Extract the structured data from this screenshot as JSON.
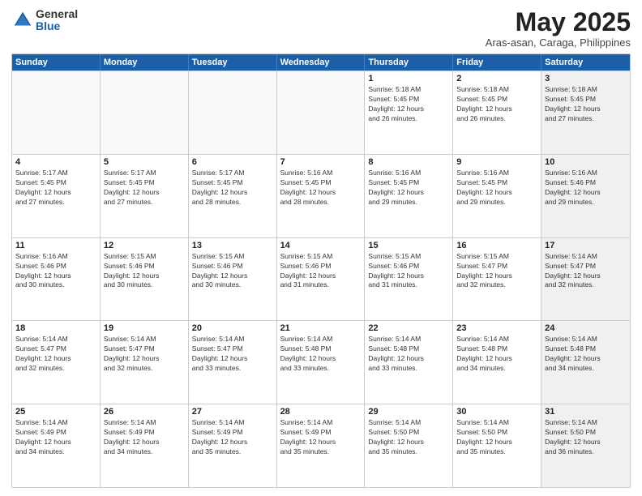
{
  "header": {
    "logo_general": "General",
    "logo_blue": "Blue",
    "month_year": "May 2025",
    "location": "Aras-asan, Caraga, Philippines"
  },
  "days_of_week": [
    "Sunday",
    "Monday",
    "Tuesday",
    "Wednesday",
    "Thursday",
    "Friday",
    "Saturday"
  ],
  "weeks": [
    [
      {
        "day": "",
        "empty": true
      },
      {
        "day": "",
        "empty": true
      },
      {
        "day": "",
        "empty": true
      },
      {
        "day": "",
        "empty": true
      },
      {
        "day": "1",
        "lines": [
          "Sunrise: 5:18 AM",
          "Sunset: 5:45 PM",
          "Daylight: 12 hours",
          "and 26 minutes."
        ]
      },
      {
        "day": "2",
        "lines": [
          "Sunrise: 5:18 AM",
          "Sunset: 5:45 PM",
          "Daylight: 12 hours",
          "and 26 minutes."
        ]
      },
      {
        "day": "3",
        "shaded": true,
        "lines": [
          "Sunrise: 5:18 AM",
          "Sunset: 5:45 PM",
          "Daylight: 12 hours",
          "and 27 minutes."
        ]
      }
    ],
    [
      {
        "day": "4",
        "lines": [
          "Sunrise: 5:17 AM",
          "Sunset: 5:45 PM",
          "Daylight: 12 hours",
          "and 27 minutes."
        ]
      },
      {
        "day": "5",
        "lines": [
          "Sunrise: 5:17 AM",
          "Sunset: 5:45 PM",
          "Daylight: 12 hours",
          "and 27 minutes."
        ]
      },
      {
        "day": "6",
        "lines": [
          "Sunrise: 5:17 AM",
          "Sunset: 5:45 PM",
          "Daylight: 12 hours",
          "and 28 minutes."
        ]
      },
      {
        "day": "7",
        "lines": [
          "Sunrise: 5:16 AM",
          "Sunset: 5:45 PM",
          "Daylight: 12 hours",
          "and 28 minutes."
        ]
      },
      {
        "day": "8",
        "lines": [
          "Sunrise: 5:16 AM",
          "Sunset: 5:45 PM",
          "Daylight: 12 hours",
          "and 29 minutes."
        ]
      },
      {
        "day": "9",
        "lines": [
          "Sunrise: 5:16 AM",
          "Sunset: 5:45 PM",
          "Daylight: 12 hours",
          "and 29 minutes."
        ]
      },
      {
        "day": "10",
        "shaded": true,
        "lines": [
          "Sunrise: 5:16 AM",
          "Sunset: 5:46 PM",
          "Daylight: 12 hours",
          "and 29 minutes."
        ]
      }
    ],
    [
      {
        "day": "11",
        "lines": [
          "Sunrise: 5:16 AM",
          "Sunset: 5:46 PM",
          "Daylight: 12 hours",
          "and 30 minutes."
        ]
      },
      {
        "day": "12",
        "lines": [
          "Sunrise: 5:15 AM",
          "Sunset: 5:46 PM",
          "Daylight: 12 hours",
          "and 30 minutes."
        ]
      },
      {
        "day": "13",
        "lines": [
          "Sunrise: 5:15 AM",
          "Sunset: 5:46 PM",
          "Daylight: 12 hours",
          "and 30 minutes."
        ]
      },
      {
        "day": "14",
        "lines": [
          "Sunrise: 5:15 AM",
          "Sunset: 5:46 PM",
          "Daylight: 12 hours",
          "and 31 minutes."
        ]
      },
      {
        "day": "15",
        "lines": [
          "Sunrise: 5:15 AM",
          "Sunset: 5:46 PM",
          "Daylight: 12 hours",
          "and 31 minutes."
        ]
      },
      {
        "day": "16",
        "lines": [
          "Sunrise: 5:15 AM",
          "Sunset: 5:47 PM",
          "Daylight: 12 hours",
          "and 32 minutes."
        ]
      },
      {
        "day": "17",
        "shaded": true,
        "lines": [
          "Sunrise: 5:14 AM",
          "Sunset: 5:47 PM",
          "Daylight: 12 hours",
          "and 32 minutes."
        ]
      }
    ],
    [
      {
        "day": "18",
        "lines": [
          "Sunrise: 5:14 AM",
          "Sunset: 5:47 PM",
          "Daylight: 12 hours",
          "and 32 minutes."
        ]
      },
      {
        "day": "19",
        "lines": [
          "Sunrise: 5:14 AM",
          "Sunset: 5:47 PM",
          "Daylight: 12 hours",
          "and 32 minutes."
        ]
      },
      {
        "day": "20",
        "lines": [
          "Sunrise: 5:14 AM",
          "Sunset: 5:47 PM",
          "Daylight: 12 hours",
          "and 33 minutes."
        ]
      },
      {
        "day": "21",
        "lines": [
          "Sunrise: 5:14 AM",
          "Sunset: 5:48 PM",
          "Daylight: 12 hours",
          "and 33 minutes."
        ]
      },
      {
        "day": "22",
        "lines": [
          "Sunrise: 5:14 AM",
          "Sunset: 5:48 PM",
          "Daylight: 12 hours",
          "and 33 minutes."
        ]
      },
      {
        "day": "23",
        "lines": [
          "Sunrise: 5:14 AM",
          "Sunset: 5:48 PM",
          "Daylight: 12 hours",
          "and 34 minutes."
        ]
      },
      {
        "day": "24",
        "shaded": true,
        "lines": [
          "Sunrise: 5:14 AM",
          "Sunset: 5:48 PM",
          "Daylight: 12 hours",
          "and 34 minutes."
        ]
      }
    ],
    [
      {
        "day": "25",
        "lines": [
          "Sunrise: 5:14 AM",
          "Sunset: 5:49 PM",
          "Daylight: 12 hours",
          "and 34 minutes."
        ]
      },
      {
        "day": "26",
        "lines": [
          "Sunrise: 5:14 AM",
          "Sunset: 5:49 PM",
          "Daylight: 12 hours",
          "and 34 minutes."
        ]
      },
      {
        "day": "27",
        "lines": [
          "Sunrise: 5:14 AM",
          "Sunset: 5:49 PM",
          "Daylight: 12 hours",
          "and 35 minutes."
        ]
      },
      {
        "day": "28",
        "lines": [
          "Sunrise: 5:14 AM",
          "Sunset: 5:49 PM",
          "Daylight: 12 hours",
          "and 35 minutes."
        ]
      },
      {
        "day": "29",
        "lines": [
          "Sunrise: 5:14 AM",
          "Sunset: 5:50 PM",
          "Daylight: 12 hours",
          "and 35 minutes."
        ]
      },
      {
        "day": "30",
        "lines": [
          "Sunrise: 5:14 AM",
          "Sunset: 5:50 PM",
          "Daylight: 12 hours",
          "and 35 minutes."
        ]
      },
      {
        "day": "31",
        "shaded": true,
        "lines": [
          "Sunrise: 5:14 AM",
          "Sunset: 5:50 PM",
          "Daylight: 12 hours",
          "and 36 minutes."
        ]
      }
    ]
  ]
}
